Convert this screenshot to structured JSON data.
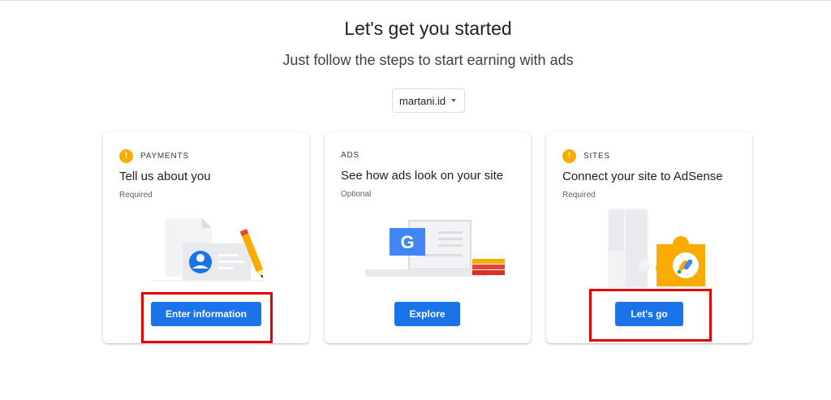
{
  "header": {
    "title": "Let's get you started",
    "subtitle": "Just follow the steps to start earning with ads"
  },
  "site_selector": {
    "value": "martani.id"
  },
  "cards": [
    {
      "label": "PAYMENTS",
      "title": "Tell us about you",
      "status": "Required",
      "button": "Enter information",
      "warning": true
    },
    {
      "label": "ADS",
      "title": "See how ads look on your site",
      "status": "Optional",
      "button": "Explore",
      "warning": false
    },
    {
      "label": "SITES",
      "title": "Connect your site to AdSense",
      "status": "Required",
      "button": "Let's go",
      "warning": true
    }
  ],
  "colors": {
    "primary": "#1a73e8",
    "warning": "#f9ab00",
    "highlight": "#e00000"
  },
  "icons": {
    "warning": "!",
    "google": "G"
  }
}
